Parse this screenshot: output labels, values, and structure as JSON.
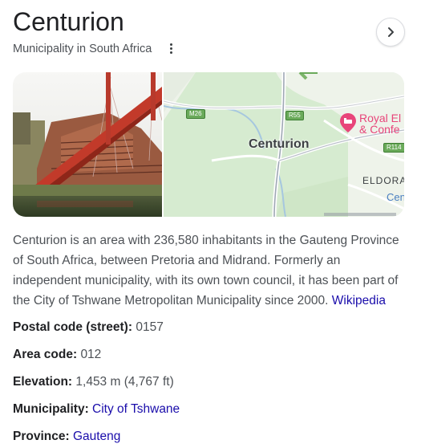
{
  "header": {
    "title": "Centurion",
    "subtitle": "Municipality in South Africa"
  },
  "map": {
    "labels": {
      "m26": "M26",
      "r55": "R55",
      "r114": "R114",
      "city": "Centurion",
      "poi": "Royal El",
      "poi2": "& Confe",
      "eldora": "ELDORA",
      "cen": "Cen"
    }
  },
  "description": {
    "text": "Centurion is an area with 236,580 inhabitants in the Gauteng Province of South Africa, between Pretoria and Midrand. Formerly an independent municipality, with its own town council, it has been part of the City of Tshwane Metropolitan Municipality since 2000.",
    "source_link": "Wikipedia"
  },
  "facts": {
    "postal_label": "Postal code (street):",
    "postal_value": "0157",
    "area_label": "Area code:",
    "area_value": "012",
    "elevation_label": "Elevation:",
    "elevation_value": "1,453 m (4,767 ft)",
    "municipality_label": "Municipality:",
    "municipality_value": "City of Tshwane",
    "province_label": "Province:",
    "province_value": "Gauteng"
  },
  "colors": {
    "link": "#1a0dab",
    "map_green": "#cde8c8",
    "map_road_highway": "#6aaa5a",
    "poi_pink": "#e8457a"
  }
}
